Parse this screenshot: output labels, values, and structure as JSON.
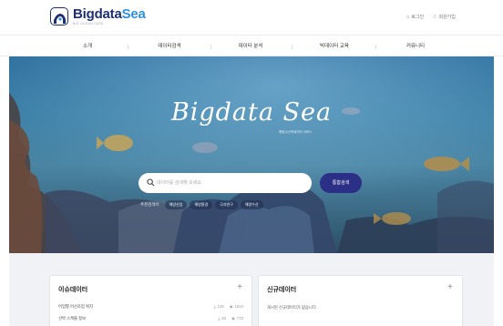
{
  "header": {
    "logo_title_a": "Bigdata",
    "logo_title_b": "Sea",
    "logo_sub": "BIG OCEAN DATA",
    "util": {
      "login": "로그인",
      "signup": "회원가입"
    }
  },
  "nav": {
    "items": [
      {
        "label": "소개"
      },
      {
        "label": "데이터검색"
      },
      {
        "label": "데이터 분석"
      },
      {
        "label": "빅데이터 교육"
      },
      {
        "label": "커뮤니티"
      }
    ]
  },
  "hero": {
    "title": "Bigdata Sea",
    "subtitle": "해양수산빅데이터 서비스",
    "search": {
      "placeholder": "데이터를 검색해 보세요.",
      "button": "통합검색"
    },
    "keywords_label": "추천검색어",
    "keywords": [
      "해양산업",
      "해양환경",
      "극지연구",
      "해양수산"
    ]
  },
  "cards": {
    "issue": {
      "title": "이슈데이터",
      "rows": [
        {
          "title": "어업별 어선조업 위치",
          "downloads": "129",
          "views": "1024"
        },
        {
          "title": "선박 스케줄 정보",
          "downloads": "93",
          "views": "773"
        }
      ]
    },
    "new": {
      "title": "신규데이터",
      "empty": "게시된 신규데이터가 없습니다."
    }
  },
  "colors": {
    "brand_navy": "#1e2f73",
    "brand_blue": "#2f8fe0",
    "button": "#2b2f86"
  }
}
